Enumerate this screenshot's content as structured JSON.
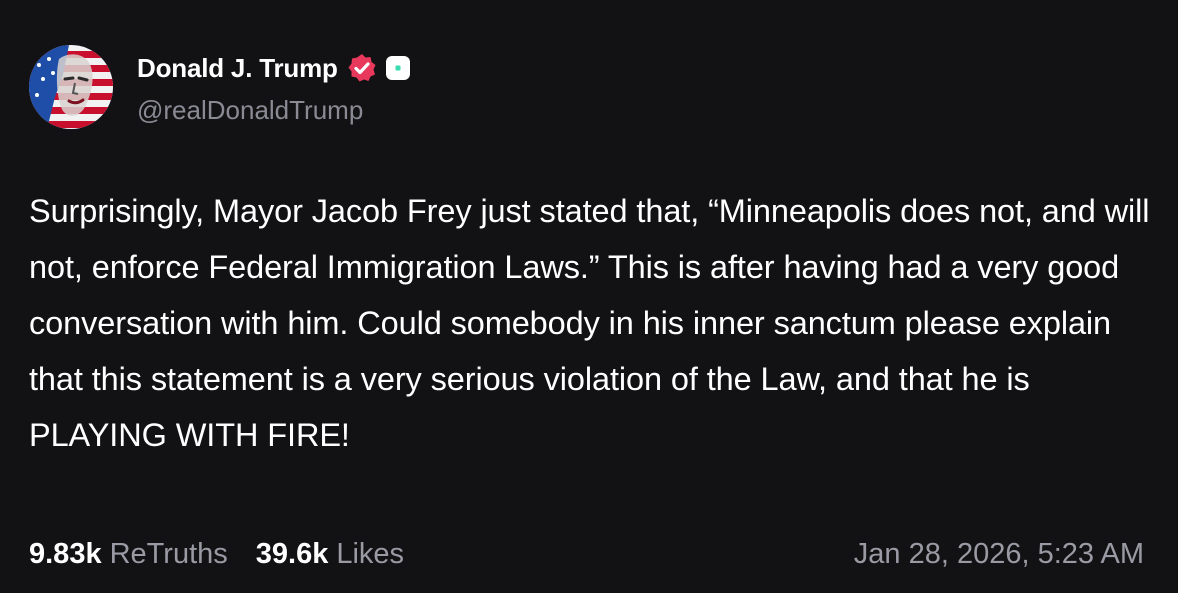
{
  "author": {
    "display_name": "Donald J. Trump",
    "handle": "@realDonaldTrump",
    "avatar_icon": "flag-portrait-avatar",
    "verified_icon": "verified-badge-icon",
    "verified_color": "#e8395c",
    "tag_icon": "square-tag-icon",
    "tag_accent": "#3ddbb0"
  },
  "post": {
    "text": "Surprisingly, Mayor Jacob Frey just stated that, “Minneapolis does not, and will not, enforce Federal Immigration Laws.” This is after having had a very good conversation with him. Could somebody in his inner sanctum please explain that this statement is a very serious violation of the Law, and that he is PLAYING WITH FIRE!"
  },
  "stats": {
    "retruths_count": "9.83k",
    "retruths_label": "ReTruths",
    "likes_count": "39.6k",
    "likes_label": "Likes"
  },
  "timestamp": "Jan 28, 2026, 5:23 AM",
  "colors": {
    "background": "#121214",
    "text": "#ffffff",
    "muted": "#9a9aa4"
  }
}
